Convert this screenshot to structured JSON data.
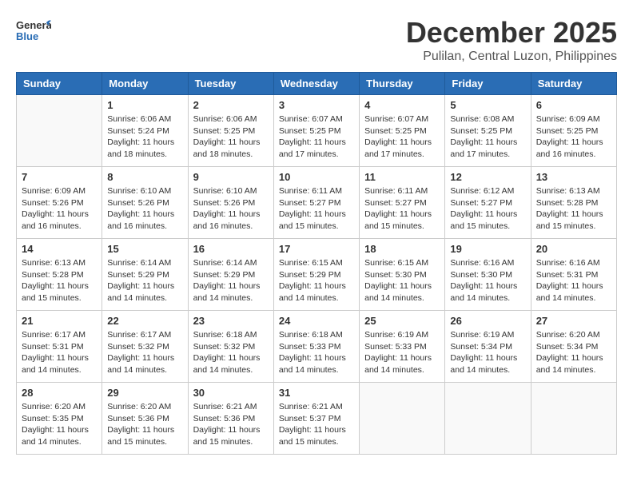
{
  "header": {
    "logo_general": "General",
    "logo_blue": "Blue",
    "month_title": "December 2025",
    "subtitle": "Pulilan, Central Luzon, Philippines"
  },
  "days_of_week": [
    "Sunday",
    "Monday",
    "Tuesday",
    "Wednesday",
    "Thursday",
    "Friday",
    "Saturday"
  ],
  "weeks": [
    [
      {
        "day": "",
        "sunrise": "",
        "sunset": "",
        "daylight": ""
      },
      {
        "day": "1",
        "sunrise": "Sunrise: 6:06 AM",
        "sunset": "Sunset: 5:24 PM",
        "daylight": "Daylight: 11 hours and 18 minutes."
      },
      {
        "day": "2",
        "sunrise": "Sunrise: 6:06 AM",
        "sunset": "Sunset: 5:25 PM",
        "daylight": "Daylight: 11 hours and 18 minutes."
      },
      {
        "day": "3",
        "sunrise": "Sunrise: 6:07 AM",
        "sunset": "Sunset: 5:25 PM",
        "daylight": "Daylight: 11 hours and 17 minutes."
      },
      {
        "day": "4",
        "sunrise": "Sunrise: 6:07 AM",
        "sunset": "Sunset: 5:25 PM",
        "daylight": "Daylight: 11 hours and 17 minutes."
      },
      {
        "day": "5",
        "sunrise": "Sunrise: 6:08 AM",
        "sunset": "Sunset: 5:25 PM",
        "daylight": "Daylight: 11 hours and 17 minutes."
      },
      {
        "day": "6",
        "sunrise": "Sunrise: 6:09 AM",
        "sunset": "Sunset: 5:25 PM",
        "daylight": "Daylight: 11 hours and 16 minutes."
      }
    ],
    [
      {
        "day": "7",
        "sunrise": "Sunrise: 6:09 AM",
        "sunset": "Sunset: 5:26 PM",
        "daylight": "Daylight: 11 hours and 16 minutes."
      },
      {
        "day": "8",
        "sunrise": "Sunrise: 6:10 AM",
        "sunset": "Sunset: 5:26 PM",
        "daylight": "Daylight: 11 hours and 16 minutes."
      },
      {
        "day": "9",
        "sunrise": "Sunrise: 6:10 AM",
        "sunset": "Sunset: 5:26 PM",
        "daylight": "Daylight: 11 hours and 16 minutes."
      },
      {
        "day": "10",
        "sunrise": "Sunrise: 6:11 AM",
        "sunset": "Sunset: 5:27 PM",
        "daylight": "Daylight: 11 hours and 15 minutes."
      },
      {
        "day": "11",
        "sunrise": "Sunrise: 6:11 AM",
        "sunset": "Sunset: 5:27 PM",
        "daylight": "Daylight: 11 hours and 15 minutes."
      },
      {
        "day": "12",
        "sunrise": "Sunrise: 6:12 AM",
        "sunset": "Sunset: 5:27 PM",
        "daylight": "Daylight: 11 hours and 15 minutes."
      },
      {
        "day": "13",
        "sunrise": "Sunrise: 6:13 AM",
        "sunset": "Sunset: 5:28 PM",
        "daylight": "Daylight: 11 hours and 15 minutes."
      }
    ],
    [
      {
        "day": "14",
        "sunrise": "Sunrise: 6:13 AM",
        "sunset": "Sunset: 5:28 PM",
        "daylight": "Daylight: 11 hours and 15 minutes."
      },
      {
        "day": "15",
        "sunrise": "Sunrise: 6:14 AM",
        "sunset": "Sunset: 5:29 PM",
        "daylight": "Daylight: 11 hours and 14 minutes."
      },
      {
        "day": "16",
        "sunrise": "Sunrise: 6:14 AM",
        "sunset": "Sunset: 5:29 PM",
        "daylight": "Daylight: 11 hours and 14 minutes."
      },
      {
        "day": "17",
        "sunrise": "Sunrise: 6:15 AM",
        "sunset": "Sunset: 5:29 PM",
        "daylight": "Daylight: 11 hours and 14 minutes."
      },
      {
        "day": "18",
        "sunrise": "Sunrise: 6:15 AM",
        "sunset": "Sunset: 5:30 PM",
        "daylight": "Daylight: 11 hours and 14 minutes."
      },
      {
        "day": "19",
        "sunrise": "Sunrise: 6:16 AM",
        "sunset": "Sunset: 5:30 PM",
        "daylight": "Daylight: 11 hours and 14 minutes."
      },
      {
        "day": "20",
        "sunrise": "Sunrise: 6:16 AM",
        "sunset": "Sunset: 5:31 PM",
        "daylight": "Daylight: 11 hours and 14 minutes."
      }
    ],
    [
      {
        "day": "21",
        "sunrise": "Sunrise: 6:17 AM",
        "sunset": "Sunset: 5:31 PM",
        "daylight": "Daylight: 11 hours and 14 minutes."
      },
      {
        "day": "22",
        "sunrise": "Sunrise: 6:17 AM",
        "sunset": "Sunset: 5:32 PM",
        "daylight": "Daylight: 11 hours and 14 minutes."
      },
      {
        "day": "23",
        "sunrise": "Sunrise: 6:18 AM",
        "sunset": "Sunset: 5:32 PM",
        "daylight": "Daylight: 11 hours and 14 minutes."
      },
      {
        "day": "24",
        "sunrise": "Sunrise: 6:18 AM",
        "sunset": "Sunset: 5:33 PM",
        "daylight": "Daylight: 11 hours and 14 minutes."
      },
      {
        "day": "25",
        "sunrise": "Sunrise: 6:19 AM",
        "sunset": "Sunset: 5:33 PM",
        "daylight": "Daylight: 11 hours and 14 minutes."
      },
      {
        "day": "26",
        "sunrise": "Sunrise: 6:19 AM",
        "sunset": "Sunset: 5:34 PM",
        "daylight": "Daylight: 11 hours and 14 minutes."
      },
      {
        "day": "27",
        "sunrise": "Sunrise: 6:20 AM",
        "sunset": "Sunset: 5:34 PM",
        "daylight": "Daylight: 11 hours and 14 minutes."
      }
    ],
    [
      {
        "day": "28",
        "sunrise": "Sunrise: 6:20 AM",
        "sunset": "Sunset: 5:35 PM",
        "daylight": "Daylight: 11 hours and 14 minutes."
      },
      {
        "day": "29",
        "sunrise": "Sunrise: 6:20 AM",
        "sunset": "Sunset: 5:36 PM",
        "daylight": "Daylight: 11 hours and 15 minutes."
      },
      {
        "day": "30",
        "sunrise": "Sunrise: 6:21 AM",
        "sunset": "Sunset: 5:36 PM",
        "daylight": "Daylight: 11 hours and 15 minutes."
      },
      {
        "day": "31",
        "sunrise": "Sunrise: 6:21 AM",
        "sunset": "Sunset: 5:37 PM",
        "daylight": "Daylight: 11 hours and 15 minutes."
      },
      {
        "day": "",
        "sunrise": "",
        "sunset": "",
        "daylight": ""
      },
      {
        "day": "",
        "sunrise": "",
        "sunset": "",
        "daylight": ""
      },
      {
        "day": "",
        "sunrise": "",
        "sunset": "",
        "daylight": ""
      }
    ]
  ]
}
